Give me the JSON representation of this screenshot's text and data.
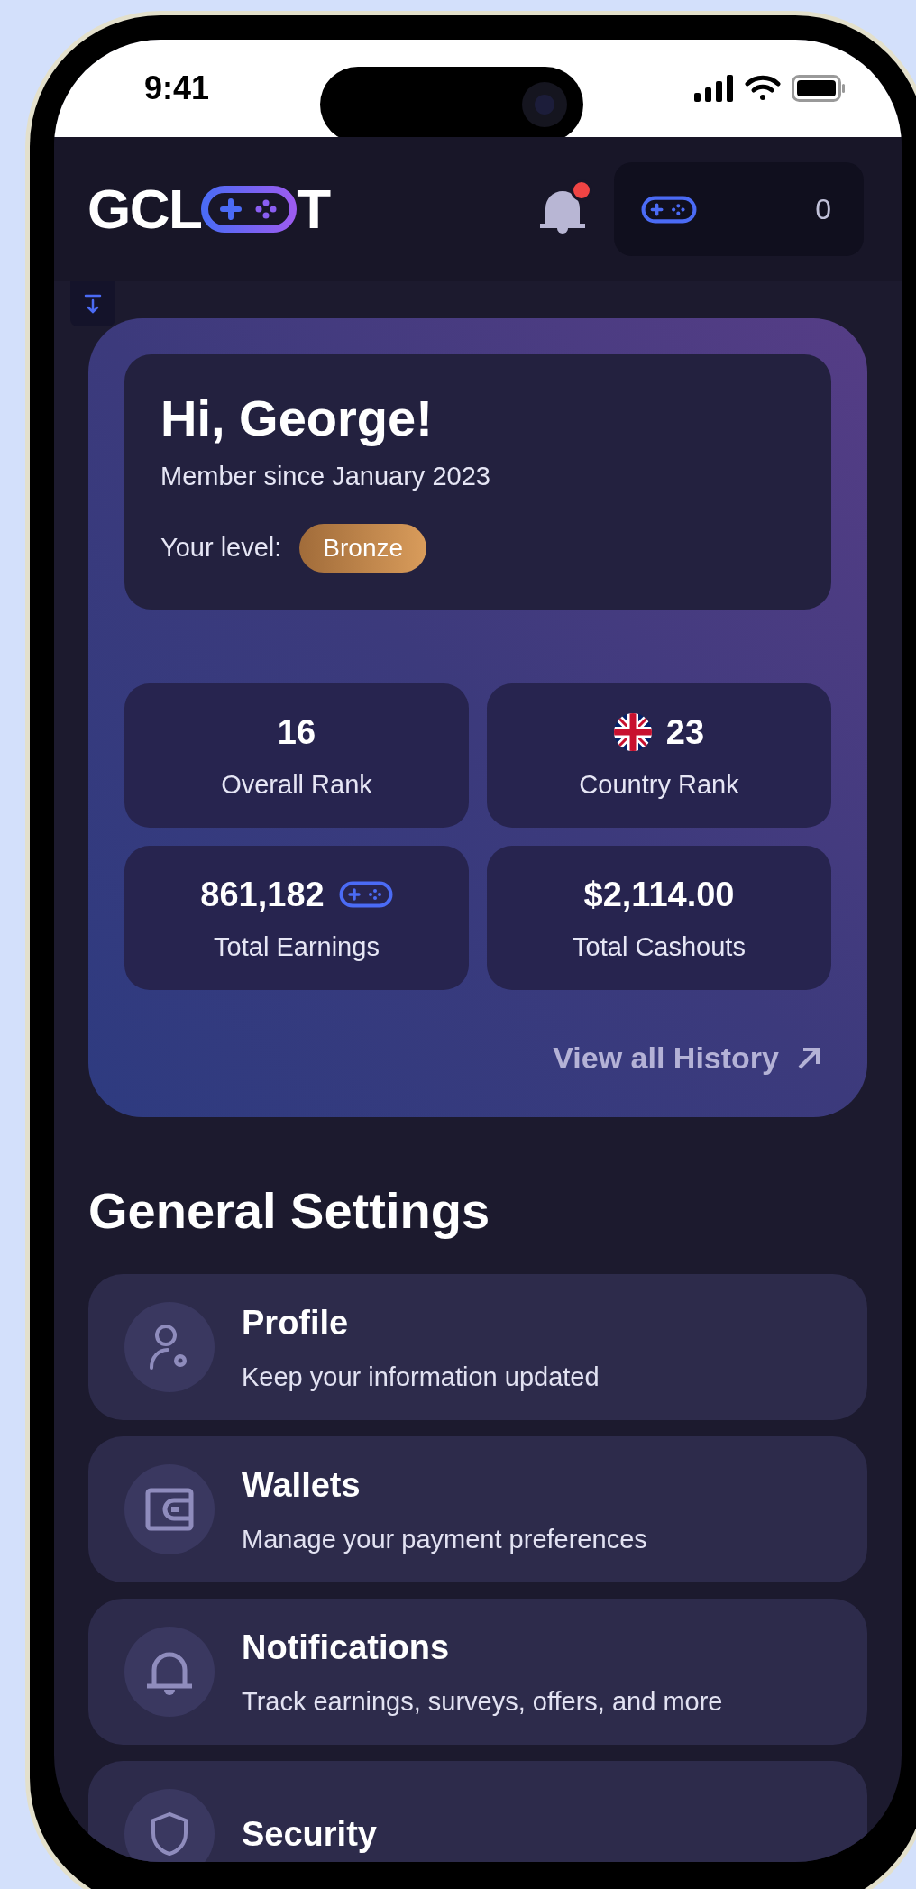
{
  "status_bar": {
    "time": "9:41"
  },
  "header": {
    "logo": {
      "left": "GCL",
      "right": "T"
    },
    "notifications": {
      "unread": true
    },
    "balance": "0"
  },
  "greeting": {
    "title": "Hi, George!",
    "member_since": "Member since January 2023",
    "level_label": "Your level:",
    "level": "Bronze"
  },
  "stats": [
    {
      "kind": "plain",
      "value": "16",
      "label": "Overall Rank"
    },
    {
      "kind": "flag",
      "value": "23",
      "label": "Country Rank"
    },
    {
      "kind": "coins",
      "value": "861,182",
      "label": "Total Earnings"
    },
    {
      "kind": "plain",
      "value": "$2,114.00",
      "label": "Total Cashouts"
    }
  ],
  "history_link": "View all History",
  "settings": {
    "title": "General Settings",
    "items": [
      {
        "kind": "profile",
        "title": "Profile",
        "description": "Keep your information updated"
      },
      {
        "kind": "wallet",
        "title": "Wallets",
        "description": "Manage your payment preferences"
      },
      {
        "kind": "notifications",
        "title": "Notifications",
        "description": "Track earnings, surveys, offers, and more"
      },
      {
        "kind": "security",
        "title": "Security"
      }
    ]
  }
}
